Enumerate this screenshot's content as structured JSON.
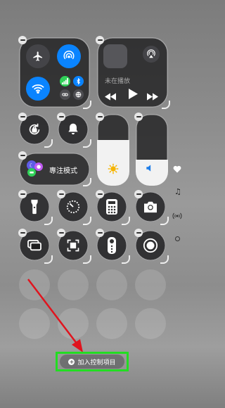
{
  "media": {
    "status": "未在播放"
  },
  "focus": {
    "label": "專注模式"
  },
  "add_controls": {
    "label": "加入控制項目"
  },
  "side_icons": {
    "music_note": "♫"
  },
  "colors": {
    "blue": "#0a84ff",
    "green": "#30d158",
    "highlight": "#22dd22",
    "arrow": "#e0141e"
  }
}
